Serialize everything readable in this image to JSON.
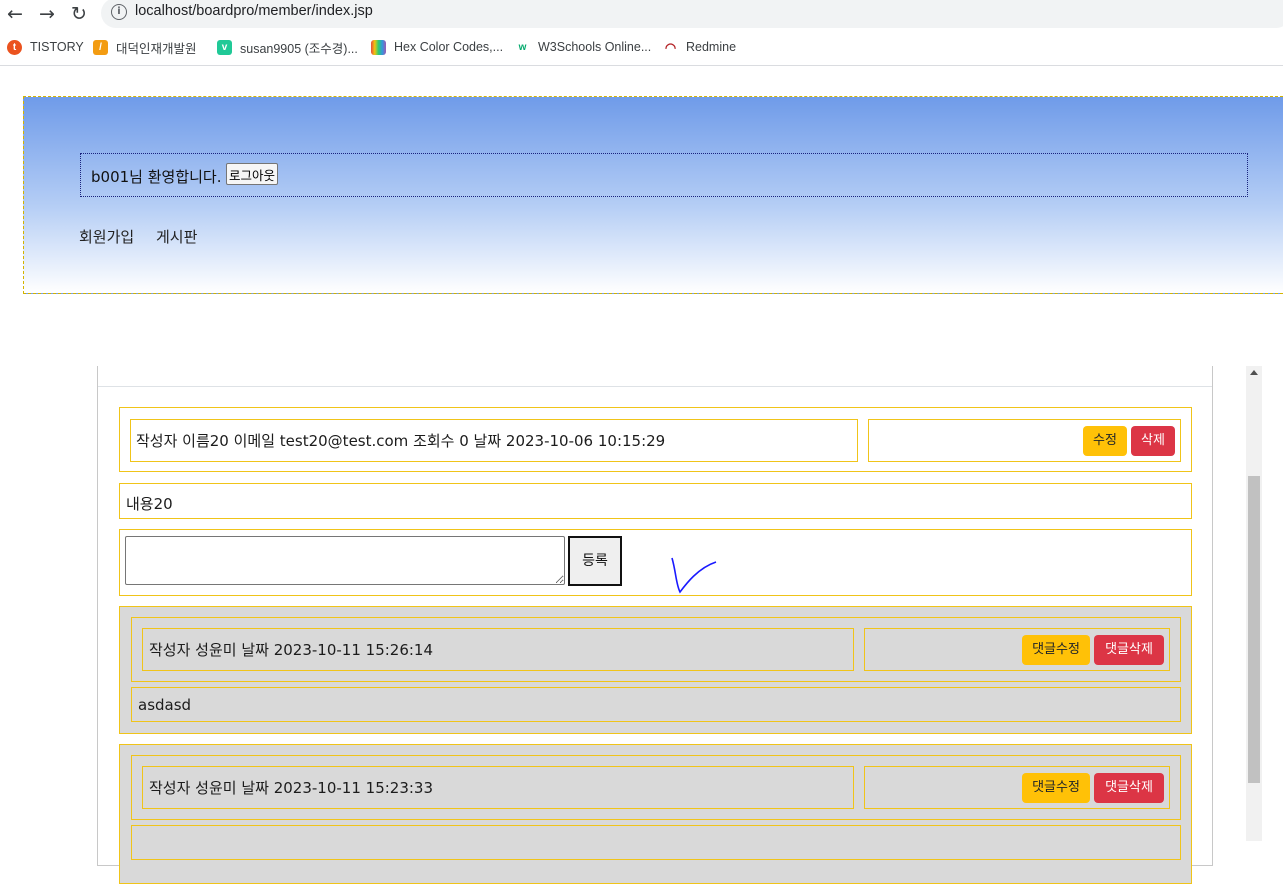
{
  "browser": {
    "url": "localhost/boardpro/member/index.jsp",
    "bookmarks": [
      {
        "label": "TISTORY",
        "icon": "tistory-icon",
        "color": "#eb531f"
      },
      {
        "label": "대덕인재개발원",
        "icon": "daedeok-icon",
        "color": "#f39c12"
      },
      {
        "label": "susan9905 (조수경)...",
        "icon": "velog-icon",
        "color": "#20c997"
      },
      {
        "label": "Hex Color Codes,...",
        "icon": "hex-color-icon",
        "color": "#7b3fa0"
      },
      {
        "label": "W3Schools Online...",
        "icon": "w3schools-icon",
        "color": "#04aa6d"
      },
      {
        "label": "Redmine",
        "icon": "redmine-icon",
        "color": "#b32024"
      }
    ]
  },
  "header": {
    "welcome": "b001님 환영합니다.",
    "logout_label": "로그아웃",
    "menu": [
      "회원가입",
      "게시판"
    ]
  },
  "post": {
    "meta": "작성자 이름20 이메일 test20@test.com 조회수 0 날짜 2023-10-06 10:15:29",
    "edit_label": "수정",
    "delete_label": "삭제",
    "content": "내용20",
    "reply_placeholder": "",
    "submit_label": "등록"
  },
  "replies": [
    {
      "meta": "작성자 성윤미 날짜 2023-10-11 15:26:14",
      "content": "asdasd",
      "edit_label": "댓글수정",
      "delete_label": "댓글삭제"
    },
    {
      "meta": "작성자 성윤미 날짜 2023-10-11 15:23:33",
      "content": "",
      "edit_label": "댓글수정",
      "delete_label": "댓글삭제"
    }
  ],
  "colors": {
    "warning": "#ffc107",
    "danger": "#dc3545",
    "border_yellow": "#f0c419",
    "reply_bg": "#d9d9d9"
  }
}
